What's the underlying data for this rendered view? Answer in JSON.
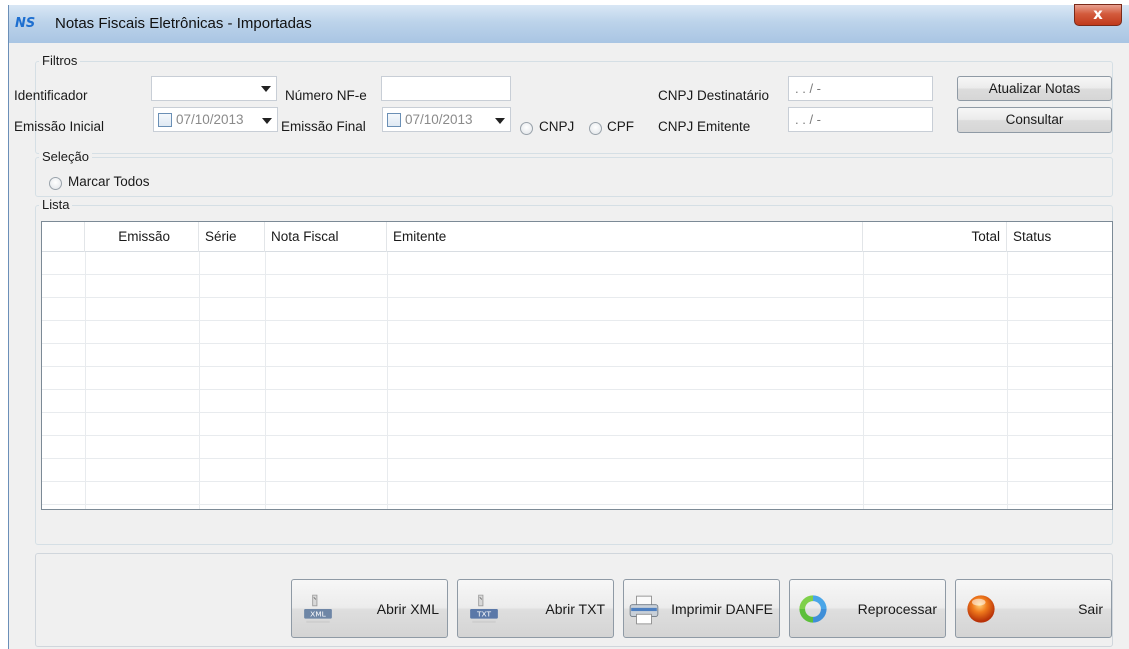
{
  "window": {
    "title": "Notas Fiscais Eletrônicas - Importadas",
    "close_glyph": "x"
  },
  "filters": {
    "group_label": "Filtros",
    "identificador_label": "Identificador",
    "identificador_value": "",
    "numero_nfe_label": "Número NF-e",
    "numero_nfe_value": "",
    "cnpj_dest_label": "CNPJ Destinatário",
    "cnpj_dest_mask": " . . /  -",
    "emissao_inicial_label": "Emissão Inicial",
    "emissao_inicial_value": "07/10/2013",
    "emissao_final_label": "Emissão Final",
    "emissao_final_value": "07/10/2013",
    "radio_cnpj_label": "CNPJ",
    "radio_cpf_label": "CPF",
    "cnpj_emit_label": "CNPJ Emitente",
    "cnpj_emit_mask": " . . /  -",
    "atualizar_label": "Atualizar Notas",
    "consultar_label": "Consultar"
  },
  "selection": {
    "group_label": "Seleção",
    "marcar_todos_label": "Marcar Todos"
  },
  "list": {
    "group_label": "Lista",
    "columns": [
      "",
      "Emissão",
      "Série",
      "Nota Fiscal",
      "Emitente",
      "Total",
      "Status"
    ]
  },
  "actions": {
    "abrir_xml": "Abrir XML",
    "xml_badge": "XML",
    "abrir_txt": "Abrir TXT",
    "txt_badge": "TXT",
    "imprimir_danfe": "Imprimir DANFE",
    "reprocessar": "Reprocessar",
    "sair": "Sair"
  }
}
